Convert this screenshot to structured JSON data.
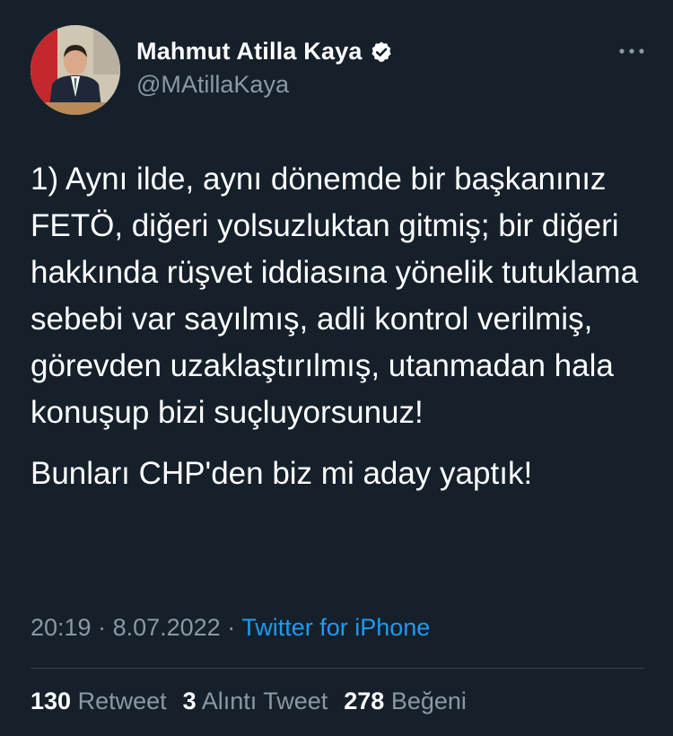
{
  "author": {
    "display_name": "Mahmut Atilla Kaya",
    "handle": "@MAtillaKaya",
    "verified_icon": "verified-badge-icon",
    "avatar_icon": "profile-photo"
  },
  "more_menu_icon": "more-options-icon",
  "tweet": {
    "paragraph_1": "1) Aynı ilde, aynı dönemde bir başkanınız FETÖ, diğeri yolsuzluktan gitmiş; bir diğeri hakkında rüşvet iddiasına yönelik tutuklama sebebi var sayılmış, adli kontrol verilmiş, görevden uzaklaştırılmış, utanmadan hala konuşup bizi suçluyorsunuz!",
    "paragraph_2": "Bunları CHP'den biz mi aday yaptık!"
  },
  "meta": {
    "time": "20:19",
    "separator": " · ",
    "date": "8.07.2022",
    "source": "Twitter for iPhone"
  },
  "stats": {
    "retweets_count": "130",
    "retweets_label": "Retweet",
    "quotes_count": "3",
    "quotes_label": "Alıntı Tweet",
    "likes_count": "278",
    "likes_label": "Beğeni"
  },
  "colors": {
    "background": "#15202b",
    "primary_text": "#ffffff",
    "secondary_text": "#8b98a5",
    "link": "#1d9bf0",
    "divider": "#38444d"
  }
}
